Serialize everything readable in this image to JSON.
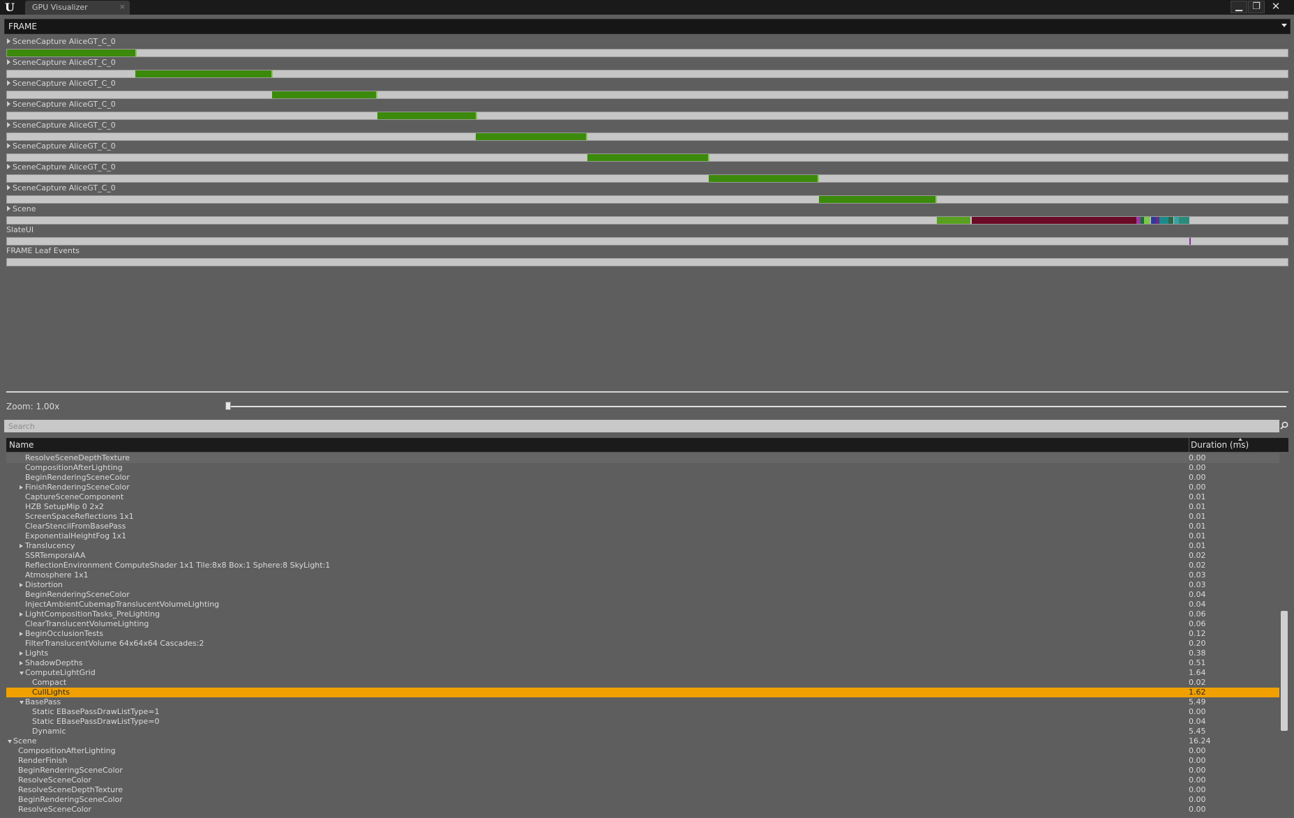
{
  "window": {
    "logo_text": "U",
    "tab_label": "GPU Visualizer",
    "tab_close": "×",
    "min_glyph": "▁",
    "max_glyph": "❐",
    "close_glyph": "✕"
  },
  "frame_select": {
    "value": "FRAME"
  },
  "timeline": {
    "rows": [
      {
        "label": "SceneCapture AliceGT_C_0",
        "expandable": true,
        "segments": [
          {
            "start": 0.0,
            "end": 0.1,
            "color": "#3c8a0c"
          }
        ]
      },
      {
        "label": "SceneCapture AliceGT_C_0",
        "expandable": true,
        "segments": [
          {
            "start": 0.1,
            "end": 0.206,
            "color": "#3c8a0c"
          }
        ]
      },
      {
        "label": "SceneCapture AliceGT_C_0",
        "expandable": true,
        "segments": [
          {
            "start": 0.207,
            "end": 0.288,
            "color": "#3c8a0c"
          }
        ]
      },
      {
        "label": "SceneCapture AliceGT_C_0",
        "expandable": true,
        "segments": [
          {
            "start": 0.289,
            "end": 0.366,
            "color": "#3c8a0c"
          }
        ]
      },
      {
        "label": "SceneCapture AliceGT_C_0",
        "expandable": true,
        "segments": [
          {
            "start": 0.366,
            "end": 0.452,
            "color": "#3c8a0c"
          }
        ]
      },
      {
        "label": "SceneCapture AliceGT_C_0",
        "expandable": true,
        "segments": [
          {
            "start": 0.453,
            "end": 0.547,
            "color": "#3c8a0c"
          }
        ]
      },
      {
        "label": "SceneCapture AliceGT_C_0",
        "expandable": true,
        "segments": [
          {
            "start": 0.548,
            "end": 0.633,
            "color": "#3c8a0c"
          }
        ]
      },
      {
        "label": "SceneCapture AliceGT_C_0",
        "expandable": true,
        "segments": [
          {
            "start": 0.634,
            "end": 0.725,
            "color": "#3c8a0c"
          }
        ]
      },
      {
        "label": "Scene",
        "expandable": true,
        "segments": [
          {
            "start": 0.726,
            "end": 0.752,
            "color": "#5aa020"
          },
          {
            "start": 0.753,
            "end": 0.882,
            "color": "#6b0a26"
          },
          {
            "start": 0.882,
            "end": 0.885,
            "color": "#9a3aa0"
          },
          {
            "start": 0.885,
            "end": 0.888,
            "color": "#1b6e3e"
          },
          {
            "start": 0.888,
            "end": 0.893,
            "color": "#7ec64a"
          },
          {
            "start": 0.893,
            "end": 0.897,
            "color": "#2f3a9a"
          },
          {
            "start": 0.897,
            "end": 0.9,
            "color": "#6a2a8a"
          },
          {
            "start": 0.9,
            "end": 0.907,
            "color": "#1d8a8a"
          },
          {
            "start": 0.907,
            "end": 0.911,
            "color": "#2a6a4a"
          },
          {
            "start": 0.911,
            "end": 0.915,
            "color": "#3aa0a0"
          },
          {
            "start": 0.915,
            "end": 0.923,
            "color": "#2b8b7a"
          }
        ]
      },
      {
        "label": "SlateUI",
        "expandable": false,
        "segments": [
          {
            "start": 0.923,
            "end": 0.924,
            "color": "#8a2aa0"
          }
        ]
      },
      {
        "label": "FRAME Leaf Events",
        "expandable": false,
        "segments": []
      }
    ]
  },
  "zoom": {
    "label": "Zoom: 1.00x",
    "value": 0.0
  },
  "search": {
    "placeholder": "Search"
  },
  "table": {
    "col_name": "Name",
    "col_duration": "Duration (ms)",
    "rows": [
      {
        "name": "ResolveSceneDepthTexture",
        "duration": "0.00",
        "depth": 2,
        "toggle": "none"
      },
      {
        "name": "CompositionAfterLighting",
        "duration": "0.00",
        "depth": 2,
        "toggle": "none"
      },
      {
        "name": "BeginRenderingSceneColor",
        "duration": "0.00",
        "depth": 2,
        "toggle": "none"
      },
      {
        "name": "FinishRenderingSceneColor",
        "duration": "0.00",
        "depth": 2,
        "toggle": "expand"
      },
      {
        "name": "CaptureSceneComponent",
        "duration": "0.01",
        "depth": 2,
        "toggle": "none"
      },
      {
        "name": "HZB SetupMip 0 2x2",
        "duration": "0.01",
        "depth": 2,
        "toggle": "none"
      },
      {
        "name": "ScreenSpaceReflections 1x1",
        "duration": "0.01",
        "depth": 2,
        "toggle": "none"
      },
      {
        "name": "ClearStencilFromBasePass",
        "duration": "0.01",
        "depth": 2,
        "toggle": "none"
      },
      {
        "name": "ExponentialHeightFog 1x1",
        "duration": "0.01",
        "depth": 2,
        "toggle": "none"
      },
      {
        "name": "Translucency",
        "duration": "0.01",
        "depth": 2,
        "toggle": "expand"
      },
      {
        "name": "SSRTemporalAA",
        "duration": "0.02",
        "depth": 2,
        "toggle": "none"
      },
      {
        "name": "ReflectionEnvironment ComputeShader 1x1 Tile:8x8 Box:1 Sphere:8 SkyLight:1",
        "duration": "0.02",
        "depth": 2,
        "toggle": "none"
      },
      {
        "name": "Atmosphere 1x1",
        "duration": "0.03",
        "depth": 2,
        "toggle": "none"
      },
      {
        "name": "Distortion",
        "duration": "0.03",
        "depth": 2,
        "toggle": "expand"
      },
      {
        "name": "BeginRenderingSceneColor",
        "duration": "0.04",
        "depth": 2,
        "toggle": "none"
      },
      {
        "name": "InjectAmbientCubemapTranslucentVolumeLighting",
        "duration": "0.04",
        "depth": 2,
        "toggle": "none"
      },
      {
        "name": "LightCompositionTasks_PreLighting",
        "duration": "0.06",
        "depth": 2,
        "toggle": "expand"
      },
      {
        "name": "ClearTranslucentVolumeLighting",
        "duration": "0.06",
        "depth": 2,
        "toggle": "none"
      },
      {
        "name": "BeginOcclusionTests",
        "duration": "0.12",
        "depth": 2,
        "toggle": "expand"
      },
      {
        "name": "FilterTranslucentVolume 64x64x64 Cascades:2",
        "duration": "0.20",
        "depth": 2,
        "toggle": "none"
      },
      {
        "name": "Lights",
        "duration": "0.38",
        "depth": 2,
        "toggle": "expand"
      },
      {
        "name": "ShadowDepths",
        "duration": "0.51",
        "depth": 2,
        "toggle": "expand"
      },
      {
        "name": "ComputeLightGrid",
        "duration": "1.64",
        "depth": 2,
        "toggle": "collapse"
      },
      {
        "name": "Compact",
        "duration": "0.02",
        "depth": 3,
        "toggle": "none"
      },
      {
        "name": "CullLights",
        "duration": "1.62",
        "depth": 3,
        "toggle": "none",
        "selected": true
      },
      {
        "name": "BasePass",
        "duration": "5.49",
        "depth": 2,
        "toggle": "collapse"
      },
      {
        "name": "Static EBasePassDrawListType=1",
        "duration": "0.00",
        "depth": 3,
        "toggle": "none"
      },
      {
        "name": "Static EBasePassDrawListType=0",
        "duration": "0.04",
        "depth": 3,
        "toggle": "none"
      },
      {
        "name": "Dynamic",
        "duration": "5.45",
        "depth": 3,
        "toggle": "none"
      },
      {
        "name": "Scene",
        "duration": "16.24",
        "depth": 0,
        "toggle": "collapse"
      },
      {
        "name": "CompositionAfterLighting",
        "duration": "0.00",
        "depth": 1,
        "toggle": "none"
      },
      {
        "name": "RenderFinish",
        "duration": "0.00",
        "depth": 1,
        "toggle": "none"
      },
      {
        "name": "BeginRenderingSceneColor",
        "duration": "0.00",
        "depth": 1,
        "toggle": "none"
      },
      {
        "name": "ResolveSceneColor",
        "duration": "0.00",
        "depth": 1,
        "toggle": "none"
      },
      {
        "name": "ResolveSceneDepthTexture",
        "duration": "0.00",
        "depth": 1,
        "toggle": "none"
      },
      {
        "name": "BeginRenderingSceneColor",
        "duration": "0.00",
        "depth": 1,
        "toggle": "none"
      },
      {
        "name": "ResolveSceneColor",
        "duration": "0.00",
        "depth": 1,
        "toggle": "none"
      }
    ]
  },
  "colors": {
    "selected_row": "#f0a000",
    "segment_green": "#3c8a0c",
    "background": "#5e5e5e"
  },
  "icons": {
    "search": "search-icon",
    "expand": "triangle-right-icon",
    "collapse": "triangle-down-icon"
  }
}
